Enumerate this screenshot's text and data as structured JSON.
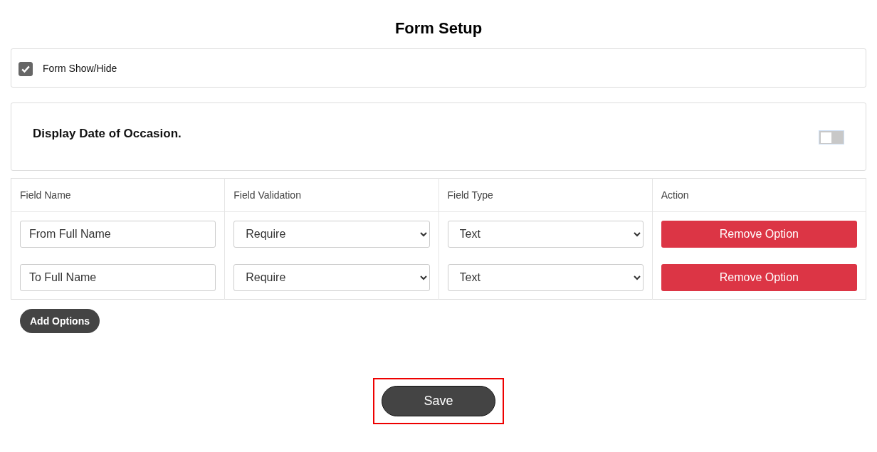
{
  "title": "Form Setup",
  "form_visibility": {
    "label": "Form Show/Hide",
    "checked": true
  },
  "date_of_occasion": {
    "label": "Display Date of Occasion.",
    "on": false
  },
  "table": {
    "columns": [
      "Field Name",
      "Field Validation",
      "Field Type",
      "Action"
    ],
    "rows": [
      {
        "field_name": "From Full Name",
        "validation": "Require",
        "type": "Text",
        "action": "Remove Option"
      },
      {
        "field_name": "To Full Name",
        "validation": "Require",
        "type": "Text",
        "action": "Remove Option"
      }
    ]
  },
  "add_button": "Add Options",
  "save": {
    "label": "Save",
    "highlighted": true
  }
}
